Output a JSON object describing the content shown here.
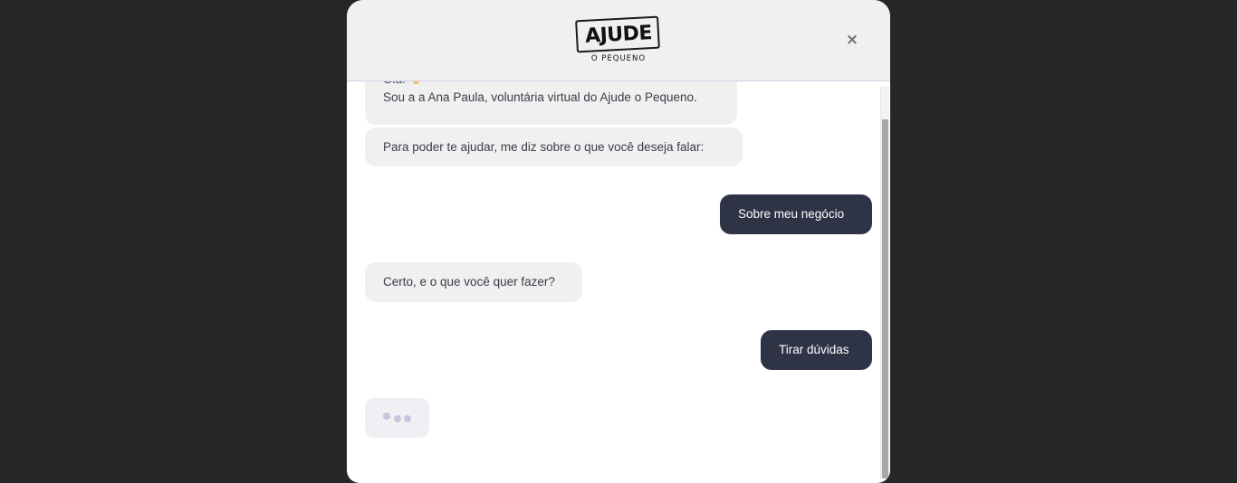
{
  "header": {
    "logo_main": "AJUDE",
    "logo_sub": "O PEQUENO",
    "close_icon": "×"
  },
  "messages": [
    {
      "from": "bot",
      "line1": "Olá!",
      "line2": "Sou a a Ana Paula, voluntária virtual do Ajude o Pequeno.",
      "icon": "waving-hand-icon"
    },
    {
      "from": "bot",
      "text": "Para poder te ajudar, me diz sobre o que você deseja falar:"
    },
    {
      "from": "user",
      "text": "Sobre meu negócio"
    },
    {
      "from": "bot",
      "text": "Certo, e o que você quer fazer?"
    },
    {
      "from": "user",
      "text": "Tirar dúvidas"
    }
  ],
  "typing_indicator": true,
  "colors": {
    "user_bubble": "#2e3346",
    "bot_bubble": "#f0f0f0",
    "header_bg": "#f0f0f0",
    "backdrop": "#262626"
  }
}
